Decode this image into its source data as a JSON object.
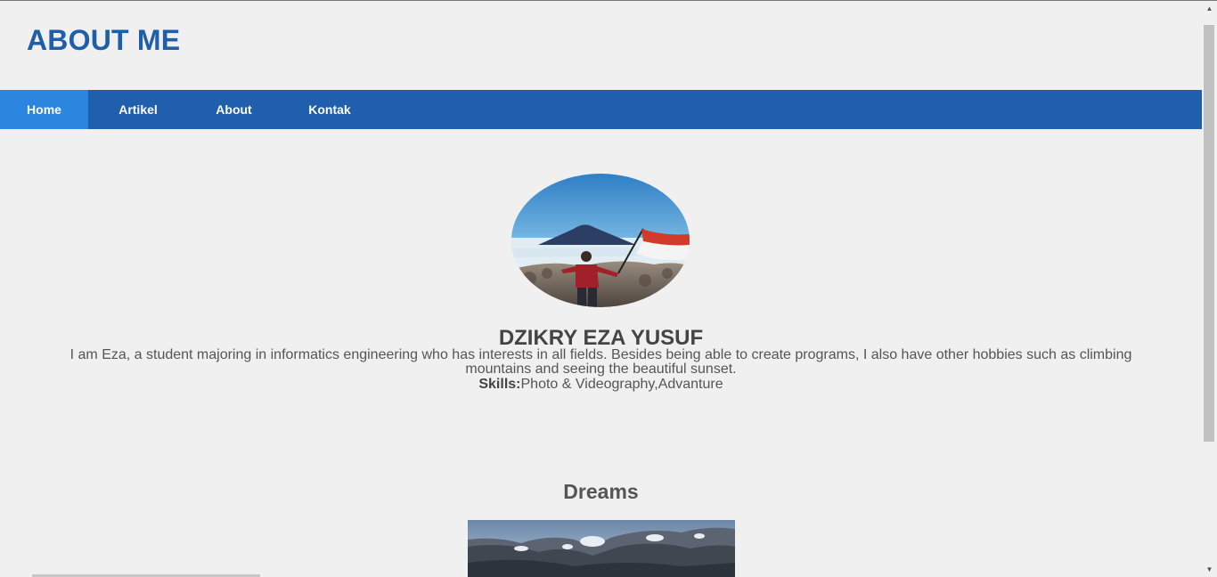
{
  "header": {
    "title": "ABOUT ME"
  },
  "nav": {
    "items": [
      {
        "label": "Home"
      },
      {
        "label": "Artikel"
      },
      {
        "label": "About"
      },
      {
        "label": "Kontak"
      }
    ]
  },
  "profile": {
    "name": "DZIKRY EZA YUSUF",
    "bio": "I am Eza, a student majoring in informatics engineering who has interests in all fields. Besides being able to create programs, I also have other hobbies such as climbing mountains and seeing the beautiful sunset.",
    "skills_label": "Skills:",
    "skills_value": "Photo & Videography,Advanture"
  },
  "dreams": {
    "title": "Dreams"
  },
  "colors": {
    "brand": "#1f5ea8",
    "nav_bg": "#1f5fab",
    "nav_active": "#2c86e0",
    "page_bg": "#f0f0f0"
  },
  "icons": {
    "scroll_up": "triangle-up-icon",
    "scroll_down": "triangle-down-icon"
  }
}
